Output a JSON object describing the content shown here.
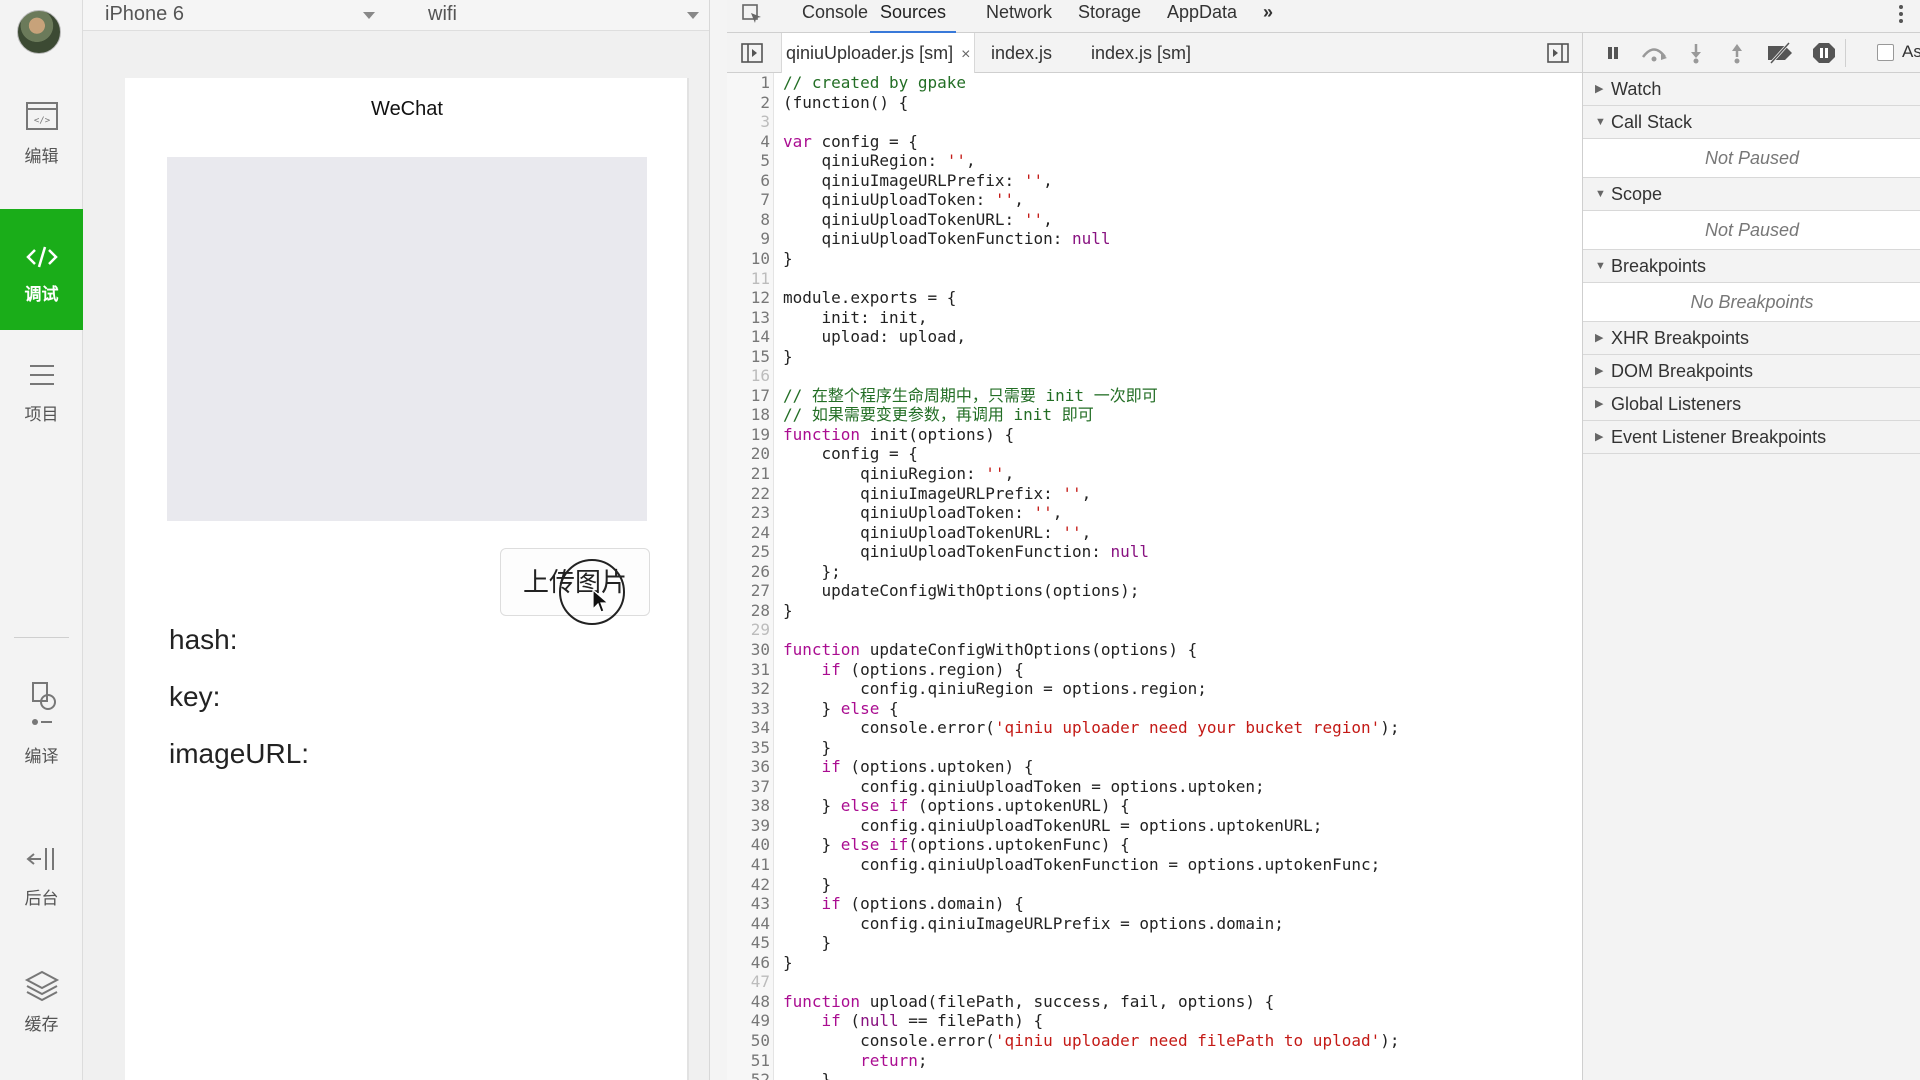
{
  "simulator": {
    "device": "iPhone 6",
    "network": "wifi",
    "page_title": "WeChat",
    "upload_button": "上传图片",
    "fields": [
      "hash:",
      "key:",
      "imageURL:"
    ]
  },
  "nav": {
    "items": [
      {
        "label": "编辑",
        "icon": "code-window-icon"
      },
      {
        "label": "调试",
        "icon": "code-brackets-icon",
        "active": true
      },
      {
        "label": "项目",
        "icon": "menu-lines-icon"
      },
      {
        "label": "编译",
        "icon": "compile-icon"
      },
      {
        "label": "后台",
        "icon": "background-icon"
      },
      {
        "label": "缓存",
        "icon": "layers-icon"
      }
    ]
  },
  "devtools": {
    "tabs": [
      "Console",
      "Sources",
      "Network",
      "Storage",
      "AppData"
    ],
    "active_tab": "Sources",
    "more": "»",
    "file_tabs": [
      {
        "name": "qiniuUploader.js [sm]",
        "active": true,
        "closable": true,
        "close": "×"
      },
      {
        "name": "index.js"
      },
      {
        "name": "index.js [sm]"
      }
    ]
  },
  "code": [
    {
      "n": "1",
      "t": [
        [
          "c",
          "// created by gpake"
        ]
      ]
    },
    {
      "n": "2",
      "t": [
        [
          "p",
          "(function() {"
        ]
      ]
    },
    {
      "n": "3",
      "t": []
    },
    {
      "n": "4",
      "t": [
        [
          "k",
          "var"
        ],
        [
          "p",
          " config = {"
        ]
      ]
    },
    {
      "n": "5",
      "t": [
        [
          "p",
          "    qiniuRegion: "
        ],
        [
          "s",
          "''"
        ],
        [
          "p",
          ","
        ]
      ]
    },
    {
      "n": "6",
      "t": [
        [
          "p",
          "    qiniuImageURLPrefix: "
        ],
        [
          "s",
          "''"
        ],
        [
          "p",
          ","
        ]
      ]
    },
    {
      "n": "7",
      "t": [
        [
          "p",
          "    qiniuUploadToken: "
        ],
        [
          "s",
          "''"
        ],
        [
          "p",
          ","
        ]
      ]
    },
    {
      "n": "8",
      "t": [
        [
          "p",
          "    qiniuUploadTokenURL: "
        ],
        [
          "s",
          "''"
        ],
        [
          "p",
          ","
        ]
      ]
    },
    {
      "n": "9",
      "t": [
        [
          "p",
          "    qiniuUploadTokenFunction: "
        ],
        [
          "n",
          "null"
        ]
      ]
    },
    {
      "n": "10",
      "t": [
        [
          "p",
          "}"
        ]
      ]
    },
    {
      "n": "11",
      "t": []
    },
    {
      "n": "12",
      "t": [
        [
          "p",
          "module.exports = {"
        ]
      ]
    },
    {
      "n": "13",
      "t": [
        [
          "p",
          "    init: init,"
        ]
      ]
    },
    {
      "n": "14",
      "t": [
        [
          "p",
          "    upload: upload,"
        ]
      ]
    },
    {
      "n": "15",
      "t": [
        [
          "p",
          "}"
        ]
      ]
    },
    {
      "n": "16",
      "t": []
    },
    {
      "n": "17",
      "t": [
        [
          "c",
          "// 在整个程序生命周期中，只需要 init 一次即可"
        ]
      ]
    },
    {
      "n": "18",
      "t": [
        [
          "c",
          "// 如果需要变更参数，再调用 init 即可"
        ]
      ]
    },
    {
      "n": "19",
      "t": [
        [
          "k",
          "function"
        ],
        [
          "p",
          " init(options) {"
        ]
      ]
    },
    {
      "n": "20",
      "t": [
        [
          "p",
          "    config = {"
        ]
      ]
    },
    {
      "n": "21",
      "t": [
        [
          "p",
          "        qiniuRegion: "
        ],
        [
          "s",
          "''"
        ],
        [
          "p",
          ","
        ]
      ]
    },
    {
      "n": "22",
      "t": [
        [
          "p",
          "        qiniuImageURLPrefix: "
        ],
        [
          "s",
          "''"
        ],
        [
          "p",
          ","
        ]
      ]
    },
    {
      "n": "23",
      "t": [
        [
          "p",
          "        qiniuUploadToken: "
        ],
        [
          "s",
          "''"
        ],
        [
          "p",
          ","
        ]
      ]
    },
    {
      "n": "24",
      "t": [
        [
          "p",
          "        qiniuUploadTokenURL: "
        ],
        [
          "s",
          "''"
        ],
        [
          "p",
          ","
        ]
      ]
    },
    {
      "n": "25",
      "t": [
        [
          "p",
          "        qiniuUploadTokenFunction: "
        ],
        [
          "n",
          "null"
        ]
      ]
    },
    {
      "n": "26",
      "t": [
        [
          "p",
          "    };"
        ]
      ]
    },
    {
      "n": "27",
      "t": [
        [
          "p",
          "    updateConfigWithOptions(options);"
        ]
      ]
    },
    {
      "n": "28",
      "t": [
        [
          "p",
          "}"
        ]
      ]
    },
    {
      "n": "29",
      "t": []
    },
    {
      "n": "30",
      "t": [
        [
          "k",
          "function"
        ],
        [
          "p",
          " updateConfigWithOptions(options) {"
        ]
      ]
    },
    {
      "n": "31",
      "t": [
        [
          "p",
          "    "
        ],
        [
          "k",
          "if"
        ],
        [
          "p",
          " (options.region) {"
        ]
      ]
    },
    {
      "n": "32",
      "t": [
        [
          "p",
          "        config.qiniuRegion = options.region;"
        ]
      ]
    },
    {
      "n": "33",
      "t": [
        [
          "p",
          "    } "
        ],
        [
          "k",
          "else"
        ],
        [
          "p",
          " {"
        ]
      ]
    },
    {
      "n": "34",
      "t": [
        [
          "p",
          "        console.error("
        ],
        [
          "s",
          "'qiniu uploader need your bucket region'"
        ],
        [
          "p",
          ");"
        ]
      ]
    },
    {
      "n": "35",
      "t": [
        [
          "p",
          "    }"
        ]
      ]
    },
    {
      "n": "36",
      "t": [
        [
          "p",
          "    "
        ],
        [
          "k",
          "if"
        ],
        [
          "p",
          " (options.uptoken) {"
        ]
      ]
    },
    {
      "n": "37",
      "t": [
        [
          "p",
          "        config.qiniuUploadToken = options.uptoken;"
        ]
      ]
    },
    {
      "n": "38",
      "t": [
        [
          "p",
          "    } "
        ],
        [
          "k",
          "else if"
        ],
        [
          "p",
          " (options.uptokenURL) {"
        ]
      ]
    },
    {
      "n": "39",
      "t": [
        [
          "p",
          "        config.qiniuUploadTokenURL = options.uptokenURL;"
        ]
      ]
    },
    {
      "n": "40",
      "t": [
        [
          "p",
          "    } "
        ],
        [
          "k",
          "else if"
        ],
        [
          "p",
          "(options.uptokenFunc) {"
        ]
      ]
    },
    {
      "n": "41",
      "t": [
        [
          "p",
          "        config.qiniuUploadTokenFunction = options.uptokenFunc;"
        ]
      ]
    },
    {
      "n": "42",
      "t": [
        [
          "p",
          "    }"
        ]
      ]
    },
    {
      "n": "43",
      "t": [
        [
          "p",
          "    "
        ],
        [
          "k",
          "if"
        ],
        [
          "p",
          " (options.domain) {"
        ]
      ]
    },
    {
      "n": "44",
      "t": [
        [
          "p",
          "        config.qiniuImageURLPrefix = options.domain;"
        ]
      ]
    },
    {
      "n": "45",
      "t": [
        [
          "p",
          "    }"
        ]
      ]
    },
    {
      "n": "46",
      "t": [
        [
          "p",
          "}"
        ]
      ]
    },
    {
      "n": "47",
      "t": []
    },
    {
      "n": "48",
      "t": [
        [
          "k",
          "function"
        ],
        [
          "p",
          " upload(filePath, success, fail, options) {"
        ]
      ]
    },
    {
      "n": "49",
      "t": [
        [
          "p",
          "    "
        ],
        [
          "k",
          "if"
        ],
        [
          "p",
          " ("
        ],
        [
          "n",
          "null"
        ],
        [
          "p",
          " == filePath) {"
        ]
      ]
    },
    {
      "n": "50",
      "t": [
        [
          "p",
          "        console.error("
        ],
        [
          "s",
          "'qiniu uploader need filePath to upload'"
        ],
        [
          "p",
          ");"
        ]
      ]
    },
    {
      "n": "51",
      "t": [
        [
          "p",
          "        "
        ],
        [
          "k",
          "return"
        ],
        [
          "p",
          ";"
        ]
      ]
    },
    {
      "n": "52",
      "t": [
        [
          "p",
          "    }"
        ]
      ]
    }
  ],
  "debugger": {
    "checkbox_label": "As",
    "sections": [
      {
        "title": "Watch",
        "expanded": false
      },
      {
        "title": "Call Stack",
        "expanded": true,
        "body": "Not Paused"
      },
      {
        "title": "Scope",
        "expanded": true,
        "body": "Not Paused"
      },
      {
        "title": "Breakpoints",
        "expanded": true,
        "body": "No Breakpoints"
      },
      {
        "title": "XHR Breakpoints",
        "expanded": false
      },
      {
        "title": "DOM Breakpoints",
        "expanded": false
      },
      {
        "title": "Global Listeners",
        "expanded": false
      },
      {
        "title": "Event Listener Breakpoints",
        "expanded": false
      }
    ]
  },
  "colors": {
    "active_nav": "#1aad19",
    "accent_tab": "#3879d9",
    "comment": "#236e25",
    "keyword": "#aa0d91",
    "string": "#c41a16"
  }
}
